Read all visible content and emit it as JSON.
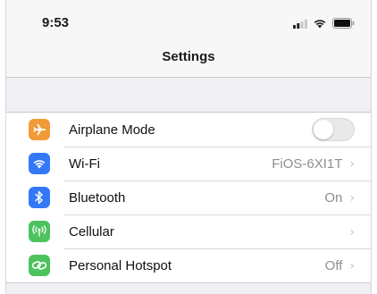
{
  "status_bar": {
    "time": "9:53",
    "icons": [
      "cellular-signal-icon",
      "wifi-icon",
      "battery-icon"
    ]
  },
  "nav": {
    "title": "Settings"
  },
  "settings": {
    "rows": [
      {
        "label": "Airplane Mode",
        "icon": "airplane-icon",
        "icon_color": "#f19a37",
        "toggle_on": false
      },
      {
        "label": "Wi-Fi",
        "icon": "wifi-icon",
        "icon_color": "#3478f6",
        "value": "FiOS-6XI1T"
      },
      {
        "label": "Bluetooth",
        "icon": "bluetooth-icon",
        "icon_color": "#3478f6",
        "value": "On"
      },
      {
        "label": "Cellular",
        "icon": "cellular-antenna-icon",
        "icon_color": "#4cc35d",
        "value": ""
      },
      {
        "label": "Personal Hotspot",
        "icon": "hotspot-link-icon",
        "icon_color": "#4cc35d",
        "value": "Off"
      }
    ]
  },
  "colors": {
    "background": "#efeff4",
    "chevron": "#c4c4c9",
    "secondary_text": "#8e8e93"
  }
}
